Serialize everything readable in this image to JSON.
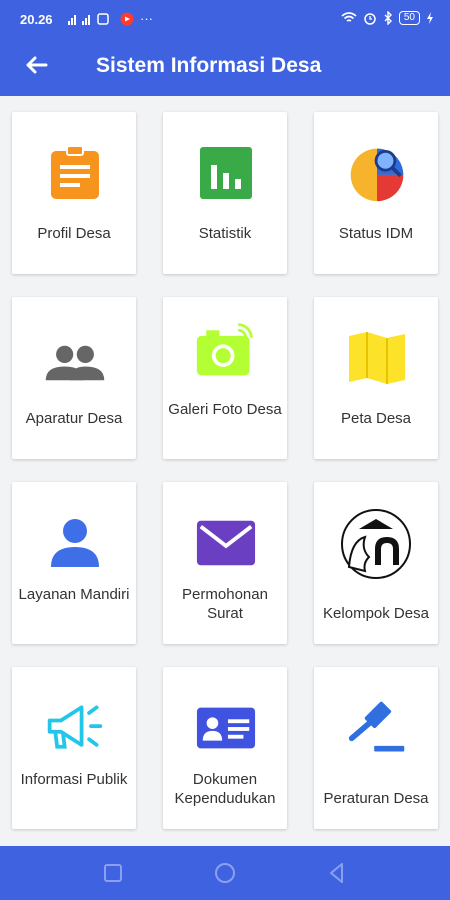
{
  "status_bar": {
    "time": "20.26",
    "signal_text": "ᵀᴵᴸ .ᴵᴵᴵ .ᴵᴵᴵ",
    "battery": "50"
  },
  "app_bar": {
    "title": "Sistem Informasi Desa"
  },
  "menu": [
    {
      "label": "Profil Desa",
      "icon": "clipboard-icon",
      "color": "#f7941d"
    },
    {
      "label": "Statistik",
      "icon": "bar-chart-icon",
      "color": "#3aaa48"
    },
    {
      "label": "Status IDM",
      "icon": "pie-chart-magnifier-icon",
      "color": "#e53935"
    },
    {
      "label": "Aparatur Desa",
      "icon": "people-icon",
      "color": "#666666"
    },
    {
      "label": "Galeri Foto Desa",
      "icon": "camera-icon",
      "color": "#b3ff33"
    },
    {
      "label": "Peta Desa",
      "icon": "map-icon",
      "color": "#fde22a"
    },
    {
      "label": "Layanan Mandiri",
      "icon": "person-icon",
      "color": "#3f6fe8"
    },
    {
      "label": "Permohonan Surat",
      "icon": "envelope-icon",
      "color": "#6a3fc2"
    },
    {
      "label": "Kelompok Desa",
      "icon": "group-logo-icon",
      "color": "#000000"
    },
    {
      "label": "Informasi Publik",
      "icon": "megaphone-icon",
      "color": "#22c6e8"
    },
    {
      "label": "Dokumen Kependudukan",
      "icon": "id-card-icon",
      "color": "#3f52e0"
    },
    {
      "label": "Peraturan Desa",
      "icon": "gavel-icon",
      "color": "#2f6fe0"
    }
  ],
  "colors": {
    "primary": "#3f62e0",
    "background": "#f2f3f5"
  }
}
